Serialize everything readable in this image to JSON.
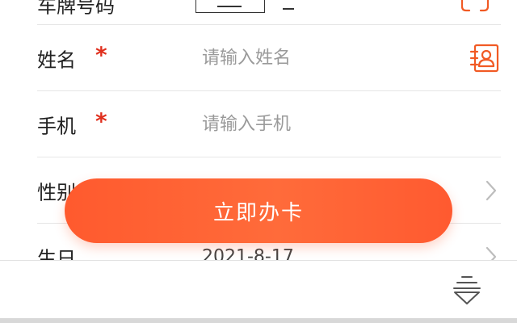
{
  "colors": {
    "accent": "#ff5a2e",
    "required": "#e0301e",
    "icon": "#f15a24"
  },
  "form": {
    "plate_row": {
      "label": "车牌号码",
      "scan_icon": "scan-icon"
    },
    "name_row": {
      "label": "姓名",
      "required_mark": "*",
      "placeholder": "请输入姓名",
      "value": "",
      "icon": "contact-card-icon"
    },
    "phone_row": {
      "label": "手机",
      "required_mark": "*",
      "placeholder": "请输入手机",
      "value": ""
    },
    "gender_row": {
      "label": "性别",
      "icon": "chevron-right-icon"
    },
    "birthday_row": {
      "label": "生日",
      "value": "2021-8-17",
      "icon": "chevron-right-icon"
    }
  },
  "cta": {
    "label": "立即办卡"
  },
  "bottom_bar": {
    "icon": "collapse-down-icon"
  }
}
